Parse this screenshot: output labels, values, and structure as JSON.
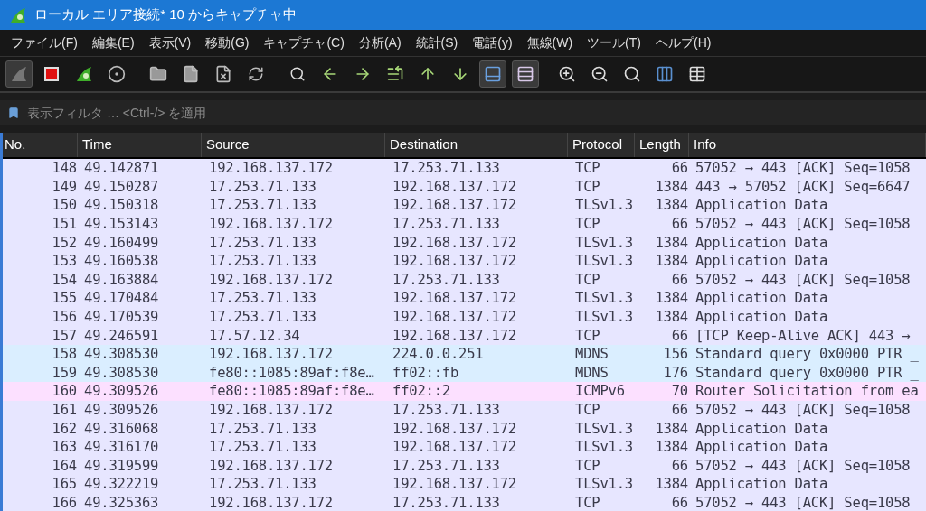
{
  "window": {
    "title": "ローカル エリア接続* 10 からキャプチャ中"
  },
  "menu": [
    "ファイル(F)",
    "編集(E)",
    "表示(V)",
    "移動(G)",
    "キャプチャ(C)",
    "分析(A)",
    "統計(S)",
    "電話(y)",
    "無線(W)",
    "ツール(T)",
    "ヘルプ(H)"
  ],
  "toolbar": [
    {
      "kind": "start",
      "pressed": true
    },
    {
      "kind": "stop",
      "pressed": false
    },
    {
      "kind": "restart",
      "pressed": false
    },
    {
      "kind": "options",
      "pressed": false
    },
    {
      "kind": "open",
      "pressed": false
    },
    {
      "kind": "save",
      "pressed": false
    },
    {
      "kind": "close",
      "pressed": false
    },
    {
      "kind": "reload",
      "pressed": false
    },
    {
      "kind": "find",
      "pressed": false
    },
    {
      "kind": "back",
      "pressed": false
    },
    {
      "kind": "forward",
      "pressed": false
    },
    {
      "kind": "goto",
      "pressed": false
    },
    {
      "kind": "first",
      "pressed": false
    },
    {
      "kind": "last",
      "pressed": false
    },
    {
      "kind": "autoscroll",
      "pressed": true
    },
    {
      "kind": "colorize",
      "pressed": true
    },
    {
      "kind": "zoomin",
      "pressed": false
    },
    {
      "kind": "zoomout",
      "pressed": false
    },
    {
      "kind": "zoomreset",
      "pressed": false
    },
    {
      "kind": "resize",
      "pressed": false
    },
    {
      "kind": "grid",
      "pressed": false
    }
  ],
  "filter": {
    "placeholder": "表示フィルタ … <Ctrl-/> を適用"
  },
  "table": {
    "columns": [
      "No.",
      "Time",
      "Source",
      "Destination",
      "Protocol",
      "Length",
      "Info"
    ],
    "rows": [
      {
        "color": "#e7e6ff",
        "cells": [
          "148",
          "49.142871",
          "192.168.137.172",
          "17.253.71.133",
          "TCP",
          "66",
          "57052 → 443 [ACK] Seq=1058"
        ]
      },
      {
        "color": "#e7e6ff",
        "cells": [
          "149",
          "49.150287",
          "17.253.71.133",
          "192.168.137.172",
          "TCP",
          "1384",
          "443 → 57052 [ACK] Seq=6647"
        ]
      },
      {
        "color": "#e7e6ff",
        "cells": [
          "150",
          "49.150318",
          "17.253.71.133",
          "192.168.137.172",
          "TLSv1.3",
          "1384",
          "Application Data"
        ]
      },
      {
        "color": "#e7e6ff",
        "cells": [
          "151",
          "49.153143",
          "192.168.137.172",
          "17.253.71.133",
          "TCP",
          "66",
          "57052 → 443 [ACK] Seq=1058"
        ]
      },
      {
        "color": "#e7e6ff",
        "cells": [
          "152",
          "49.160499",
          "17.253.71.133",
          "192.168.137.172",
          "TLSv1.3",
          "1384",
          "Application Data"
        ]
      },
      {
        "color": "#e7e6ff",
        "cells": [
          "153",
          "49.160538",
          "17.253.71.133",
          "192.168.137.172",
          "TLSv1.3",
          "1384",
          "Application Data"
        ]
      },
      {
        "color": "#e7e6ff",
        "cells": [
          "154",
          "49.163884",
          "192.168.137.172",
          "17.253.71.133",
          "TCP",
          "66",
          "57052 → 443 [ACK] Seq=1058"
        ]
      },
      {
        "color": "#e7e6ff",
        "cells": [
          "155",
          "49.170484",
          "17.253.71.133",
          "192.168.137.172",
          "TLSv1.3",
          "1384",
          "Application Data"
        ]
      },
      {
        "color": "#e7e6ff",
        "cells": [
          "156",
          "49.170539",
          "17.253.71.133",
          "192.168.137.172",
          "TLSv1.3",
          "1384",
          "Application Data"
        ]
      },
      {
        "color": "#e7e6ff",
        "cells": [
          "157",
          "49.246591",
          "17.57.12.34",
          "192.168.137.172",
          "TCP",
          "66",
          "[TCP Keep-Alive ACK] 443 →"
        ]
      },
      {
        "color": "#daeeff",
        "cells": [
          "158",
          "49.308530",
          "192.168.137.172",
          "224.0.0.251",
          "MDNS",
          "156",
          "Standard query 0x0000 PTR _"
        ]
      },
      {
        "color": "#daeeff",
        "cells": [
          "159",
          "49.308530",
          "fe80::1085:89af:f8e…",
          "ff02::fb",
          "MDNS",
          "176",
          "Standard query 0x0000 PTR _"
        ]
      },
      {
        "color": "#fce0ff",
        "cells": [
          "160",
          "49.309526",
          "fe80::1085:89af:f8e…",
          "ff02::2",
          "ICMPv6",
          "70",
          "Router Solicitation from ea"
        ]
      },
      {
        "color": "#e7e6ff",
        "cells": [
          "161",
          "49.309526",
          "192.168.137.172",
          "17.253.71.133",
          "TCP",
          "66",
          "57052 → 443 [ACK] Seq=1058"
        ]
      },
      {
        "color": "#e7e6ff",
        "cells": [
          "162",
          "49.316068",
          "17.253.71.133",
          "192.168.137.172",
          "TLSv1.3",
          "1384",
          "Application Data"
        ]
      },
      {
        "color": "#e7e6ff",
        "cells": [
          "163",
          "49.316170",
          "17.253.71.133",
          "192.168.137.172",
          "TLSv1.3",
          "1384",
          "Application Data"
        ]
      },
      {
        "color": "#e7e6ff",
        "cells": [
          "164",
          "49.319599",
          "192.168.137.172",
          "17.253.71.133",
          "TCP",
          "66",
          "57052 → 443 [ACK] Seq=1058"
        ]
      },
      {
        "color": "#e7e6ff",
        "cells": [
          "165",
          "49.322219",
          "17.253.71.133",
          "192.168.137.172",
          "TLSv1.3",
          "1384",
          "Application Data"
        ]
      },
      {
        "color": "#e7e6ff",
        "cells": [
          "166",
          "49.325363",
          "192.168.137.172",
          "17.253.71.133",
          "TCP",
          "66",
          "57052 → 443 [ACK] Seq=1058"
        ]
      }
    ]
  }
}
